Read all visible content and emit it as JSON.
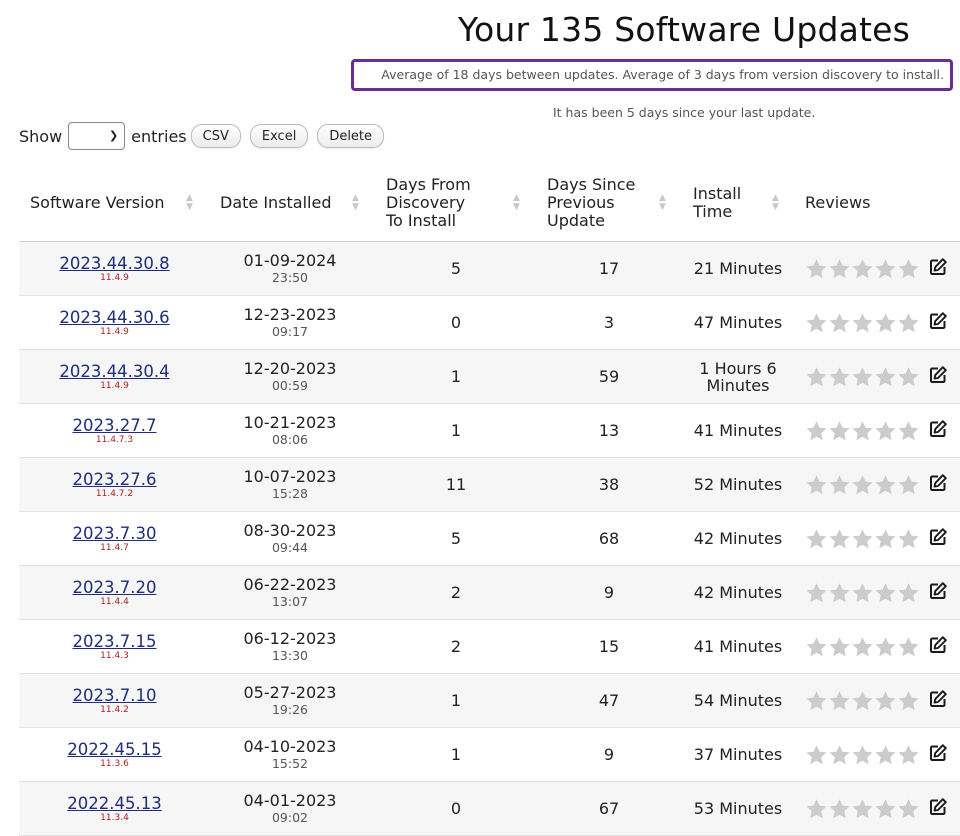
{
  "header": {
    "title": "Your 135 Software Updates",
    "stats": "Average of 18 days between updates. Average of 3 days from version discovery to install.",
    "last_update": "It has been 5 days since your last update."
  },
  "controls": {
    "show_label": "Show",
    "entries_label": "entries",
    "selected_value": "",
    "buttons": [
      "CSV",
      "Excel",
      "Delete"
    ]
  },
  "table": {
    "columns": [
      [
        "Software Version"
      ],
      [
        "Date Installed"
      ],
      [
        "Days From",
        "Discovery",
        "To Install"
      ],
      [
        "Days Since",
        "Previous",
        "Update"
      ],
      [
        "Install",
        "Time"
      ],
      [
        "Reviews"
      ]
    ],
    "star_color": "#cccccc",
    "rows": [
      {
        "version": "2023.44.30.8",
        "sub": "11.4.9",
        "date": "01-09-2024",
        "time": "23:50",
        "discovery": "5",
        "since": "17",
        "install": [
          "21 Minutes"
        ],
        "rating": 0
      },
      {
        "version": "2023.44.30.6",
        "sub": "11.4.9",
        "date": "12-23-2023",
        "time": "09:17",
        "discovery": "0",
        "since": "3",
        "install": [
          "47 Minutes"
        ],
        "rating": 0
      },
      {
        "version": "2023.44.30.4",
        "sub": "11.4.9",
        "date": "12-20-2023",
        "time": "00:59",
        "discovery": "1",
        "since": "59",
        "install": [
          "1 Hours 6",
          "Minutes"
        ],
        "rating": 0
      },
      {
        "version": "2023.27.7",
        "sub": "11.4.7.3",
        "date": "10-21-2023",
        "time": "08:06",
        "discovery": "1",
        "since": "13",
        "install": [
          "41 Minutes"
        ],
        "rating": 0
      },
      {
        "version": "2023.27.6",
        "sub": "11.4.7.2",
        "date": "10-07-2023",
        "time": "15:28",
        "discovery": "11",
        "since": "38",
        "install": [
          "52 Minutes"
        ],
        "rating": 0
      },
      {
        "version": "2023.7.30",
        "sub": "11.4.7",
        "date": "08-30-2023",
        "time": "09:44",
        "discovery": "5",
        "since": "68",
        "install": [
          "42 Minutes"
        ],
        "rating": 0
      },
      {
        "version": "2023.7.20",
        "sub": "11.4.4",
        "date": "06-22-2023",
        "time": "13:07",
        "discovery": "2",
        "since": "9",
        "install": [
          "42 Minutes"
        ],
        "rating": 0
      },
      {
        "version": "2023.7.15",
        "sub": "11.4.3",
        "date": "06-12-2023",
        "time": "13:30",
        "discovery": "2",
        "since": "15",
        "install": [
          "41 Minutes"
        ],
        "rating": 0
      },
      {
        "version": "2023.7.10",
        "sub": "11.4.2",
        "date": "05-27-2023",
        "time": "19:26",
        "discovery": "1",
        "since": "47",
        "install": [
          "54 Minutes"
        ],
        "rating": 0
      },
      {
        "version": "2022.45.15",
        "sub": "11.3.6",
        "date": "04-10-2023",
        "time": "15:52",
        "discovery": "1",
        "since": "9",
        "install": [
          "37 Minutes"
        ],
        "rating": 0
      },
      {
        "version": "2022.45.13",
        "sub": "11.3.4",
        "date": "04-01-2023",
        "time": "09:02",
        "discovery": "0",
        "since": "67",
        "install": [
          "53 Minutes"
        ],
        "rating": 0
      }
    ]
  }
}
